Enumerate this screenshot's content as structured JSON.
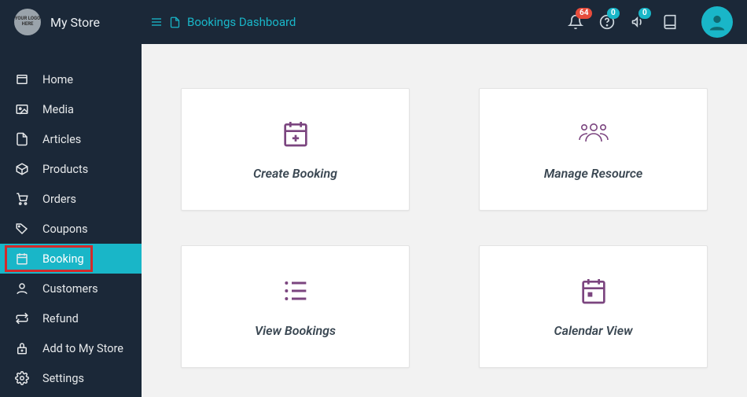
{
  "header": {
    "logo_text": "YOUR LOGO HERE",
    "store_name": "My Store",
    "breadcrumb": "Bookings Dashboard",
    "notifications_badge": "64",
    "help_badge": "0",
    "announce_badge": "0"
  },
  "sidebar": {
    "items": [
      {
        "label": "Home",
        "icon": "home-icon"
      },
      {
        "label": "Media",
        "icon": "media-icon"
      },
      {
        "label": "Articles",
        "icon": "articles-icon"
      },
      {
        "label": "Products",
        "icon": "products-icon"
      },
      {
        "label": "Orders",
        "icon": "orders-icon"
      },
      {
        "label": "Coupons",
        "icon": "coupons-icon"
      },
      {
        "label": "Booking",
        "icon": "booking-icon",
        "active": true,
        "highlighted": true
      },
      {
        "label": "Customers",
        "icon": "customers-icon"
      },
      {
        "label": "Refund",
        "icon": "refund-icon"
      },
      {
        "label": "Add to My Store",
        "icon": "add-store-icon"
      },
      {
        "label": "Settings",
        "icon": "settings-icon"
      }
    ]
  },
  "tiles": [
    {
      "label": "Create Booking",
      "icon": "create-booking-icon"
    },
    {
      "label": "Manage Resource",
      "icon": "manage-resource-icon"
    },
    {
      "label": "View Bookings",
      "icon": "view-bookings-icon"
    },
    {
      "label": "Calendar View",
      "icon": "calendar-view-icon"
    }
  ],
  "colors": {
    "accent": "#19b6c8",
    "dark": "#1b2838",
    "tile_icon": "#7b457f",
    "highlight_border": "#d42a2a",
    "arrow": "#e4261e"
  }
}
